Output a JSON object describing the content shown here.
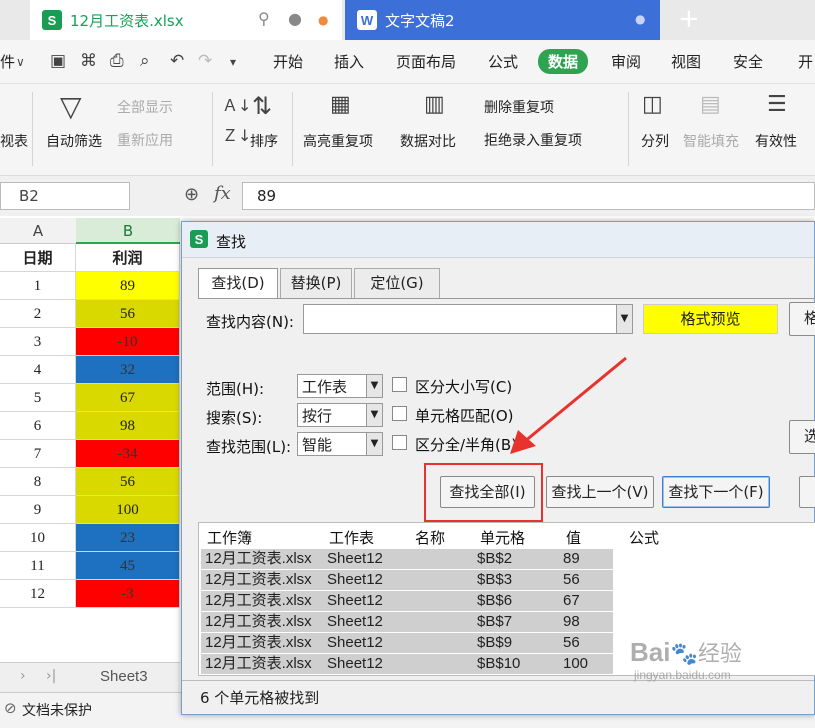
{
  "tabs": [
    {
      "label": "12月工资表.xlsx",
      "icon": "S"
    },
    {
      "label": "文字文稿2",
      "icon": "W"
    }
  ],
  "new_tab": "+",
  "menu": [
    "开始",
    "插入",
    "页面布局",
    "公式",
    "数据",
    "审阅",
    "视图",
    "安全",
    "开"
  ],
  "menu_left": "件",
  "ribbon": {
    "left_cut": "视表",
    "autofilter": "自动筛选",
    "show_all": "全部显示",
    "reapply": "重新应用",
    "sort": "排序",
    "highlight_dup": "高亮重复项",
    "data_compare": "数据对比",
    "remove_dup": "删除重复项",
    "reject_dup": "拒绝录入重复项",
    "split": "分列",
    "smart_fill": "智能填充",
    "validity": "有效性"
  },
  "formula": {
    "namebox": "B2",
    "fx": "fx",
    "value": "89"
  },
  "columns": [
    "A",
    "B"
  ],
  "header_cells": [
    "日期",
    "利润"
  ],
  "rows": [
    {
      "n": "1",
      "v": "89",
      "c": "#ffff00"
    },
    {
      "n": "2",
      "v": "56",
      "c": "#d9d900"
    },
    {
      "n": "3",
      "v": "-10",
      "c": "#ff0000"
    },
    {
      "n": "4",
      "v": "32",
      "c": "#1e70c1"
    },
    {
      "n": "5",
      "v": "67",
      "c": "#d9d900"
    },
    {
      "n": "6",
      "v": "98",
      "c": "#d9d900"
    },
    {
      "n": "7",
      "v": "-34",
      "c": "#ff0000"
    },
    {
      "n": "8",
      "v": "56",
      "c": "#d9d900"
    },
    {
      "n": "9",
      "v": "100",
      "c": "#d9d900"
    },
    {
      "n": "10",
      "v": "23",
      "c": "#1e70c1"
    },
    {
      "n": "11",
      "v": "45",
      "c": "#1e70c1"
    },
    {
      "n": "12",
      "v": "-3",
      "c": "#ff0000"
    }
  ],
  "sheet_tab": "Sheet3",
  "status": "文档未保护",
  "dialog": {
    "title": "查找",
    "tabs": [
      "查找(D)",
      "替换(P)",
      "定位(G)"
    ],
    "find_label": "查找内容(N):",
    "format_preview": "格式预览",
    "format_btn_cut": "格",
    "scope_label": "范围(H):",
    "scope_value": "工作表",
    "search_label": "搜索(S):",
    "search_value": "按行",
    "lookin_label": "查找范围(L):",
    "lookin_value": "智能",
    "case": "区分大小写(C)",
    "cell_match": "单元格匹配(O)",
    "width": "区分全/半角(B)",
    "options_cut": "选",
    "find_all": "查找全部(I)",
    "find_prev": "查找上一个(V)",
    "find_next": "查找下一个(F)",
    "result_headers": [
      "工作簿",
      "工作表",
      "名称",
      "单元格",
      "值",
      "公式"
    ],
    "results": [
      [
        "12月工资表.xlsx",
        "Sheet12",
        "",
        "$B$2",
        "89",
        ""
      ],
      [
        "12月工资表.xlsx",
        "Sheet12",
        "",
        "$B$3",
        "56",
        ""
      ],
      [
        "12月工资表.xlsx",
        "Sheet12",
        "",
        "$B$6",
        "67",
        ""
      ],
      [
        "12月工资表.xlsx",
        "Sheet12",
        "",
        "$B$7",
        "98",
        ""
      ],
      [
        "12月工资表.xlsx",
        "Sheet12",
        "",
        "$B$9",
        "56",
        ""
      ],
      [
        "12月工资表.xlsx",
        "Sheet12",
        "",
        "$B$10",
        "100",
        ""
      ]
    ],
    "found_status": "6 个单元格被找到"
  },
  "watermark": {
    "brand": "Bai",
    "brand2": "经验",
    "url": "jingyan.baidu.com"
  },
  "colors": {
    "accent_green": "#2fa352",
    "highlight": "#ffff00",
    "arrow": "#e8322e"
  }
}
